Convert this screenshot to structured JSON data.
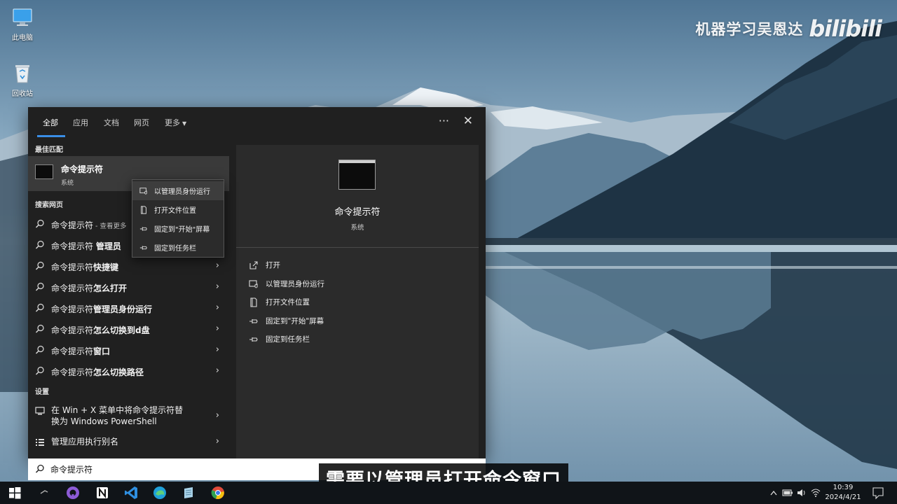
{
  "desktop": {
    "icons": [
      {
        "label": "此电脑",
        "icon": "computer-icon"
      },
      {
        "label": "回收站",
        "icon": "recycle-bin-icon"
      }
    ]
  },
  "watermark": {
    "channel": "机器学习吴恩达",
    "brand": "bilibili"
  },
  "search_panel": {
    "tabs": [
      {
        "label": "全部",
        "active": true
      },
      {
        "label": "应用"
      },
      {
        "label": "文档"
      },
      {
        "label": "网页"
      },
      {
        "label": "更多"
      }
    ],
    "ellipsis": "···",
    "close": "✕",
    "best_match_title": "最佳匹配",
    "best_match": {
      "name": "命令提示符",
      "type": "系统"
    },
    "web_title": "搜索网页",
    "web_results": [
      {
        "prefix": "命令提示符",
        "bold": "",
        "suffix": " - 查看更多"
      },
      {
        "prefix": "命令提示符 ",
        "bold": "管理员",
        "suffix": ""
      },
      {
        "prefix": "命令提示符",
        "bold": "快捷键",
        "suffix": ""
      },
      {
        "prefix": "命令提示符",
        "bold": "怎么打开",
        "suffix": ""
      },
      {
        "prefix": "命令提示符",
        "bold": "管理员身份运行",
        "suffix": ""
      },
      {
        "prefix": "命令提示符",
        "bold": "怎么切换到d盘",
        "suffix": ""
      },
      {
        "prefix": "命令提示符",
        "bold": "窗口",
        "suffix": ""
      },
      {
        "prefix": "命令提示符",
        "bold": "怎么切换路径",
        "suffix": ""
      }
    ],
    "settings_title": "设置",
    "settings": [
      {
        "line1": "在 Win + X 菜单中将命令提示符替",
        "line2": "换为 Windows PowerShell"
      },
      {
        "line1": "管理应用执行别名",
        "line2": ""
      }
    ],
    "preview": {
      "name": "命令提示符",
      "type": "系统",
      "actions": [
        "打开",
        "以管理员身份运行",
        "打开文件位置",
        "固定到\"开始\"屏幕",
        "固定到任务栏"
      ]
    },
    "context_menu": [
      "以管理员身份运行",
      "打开文件位置",
      "固定到\"开始\"屏幕",
      "固定到任务栏"
    ],
    "search_value": "命令提示符"
  },
  "subtitle": "需要以管理员打开命令窗口",
  "taskbar": {
    "time": "10:39",
    "date": "2024/4/21"
  },
  "colors": {
    "panel_bg": "#202020",
    "preview_bg": "#2b2b2b",
    "accent": "#3a8ee6",
    "taskbar_bg": "#101418"
  }
}
